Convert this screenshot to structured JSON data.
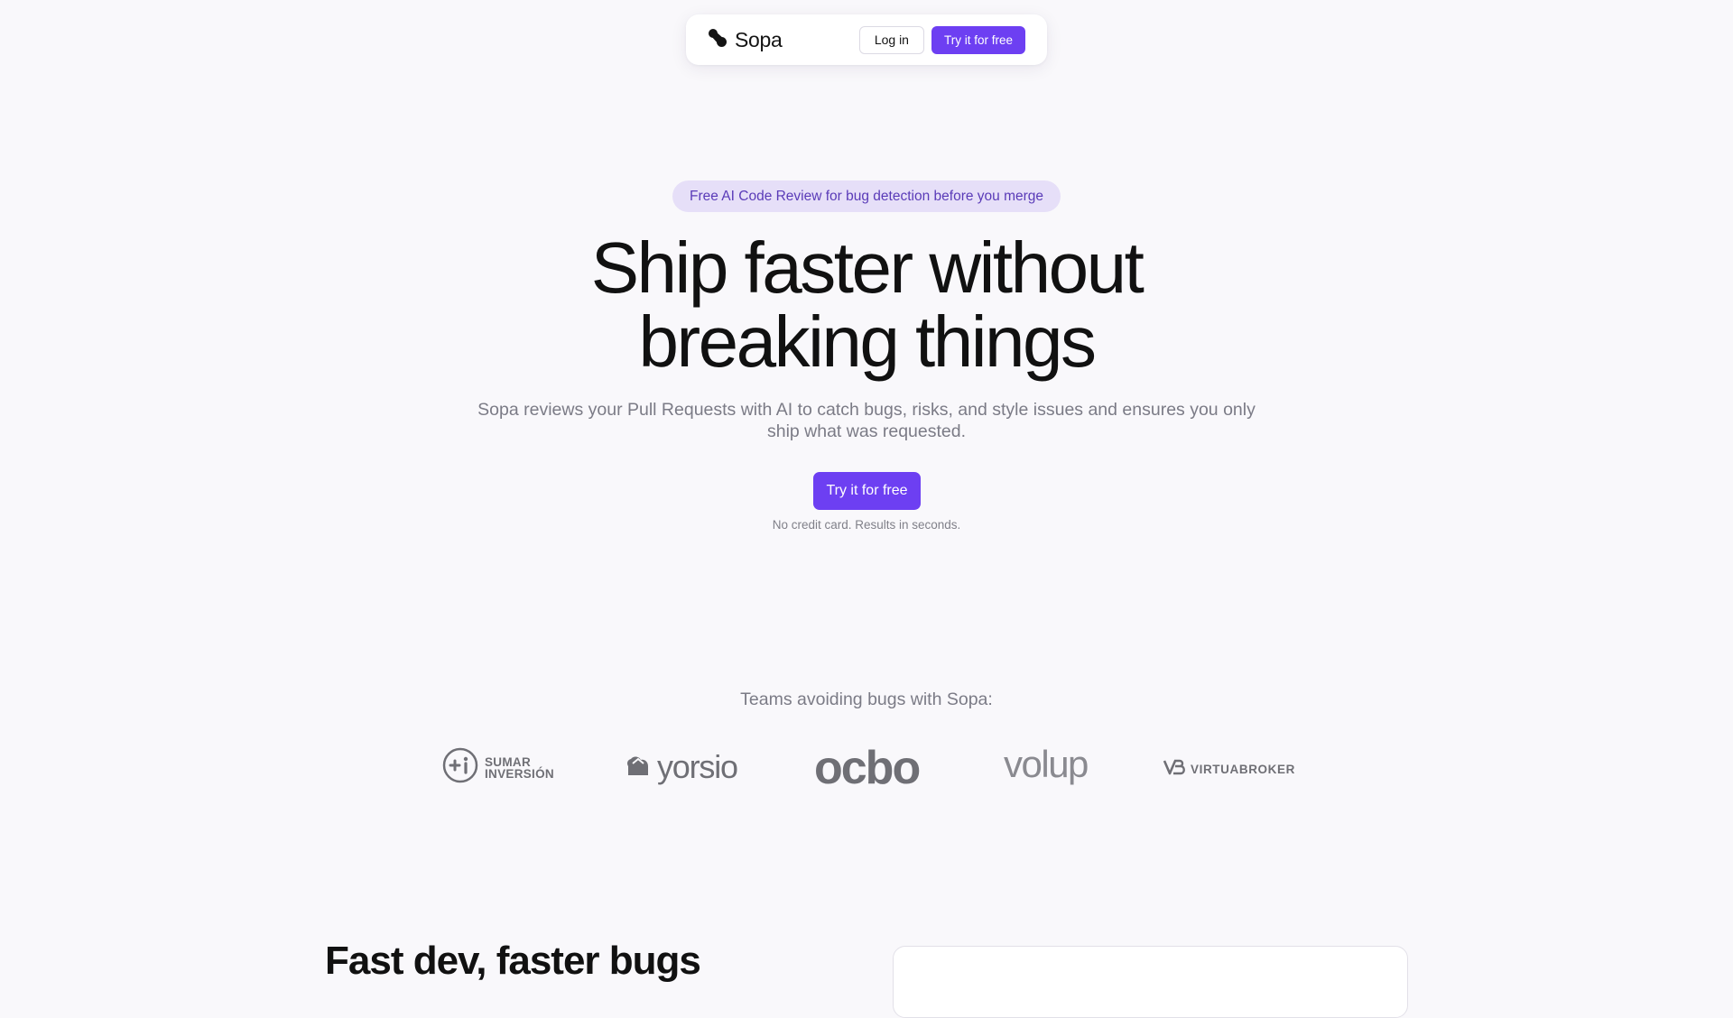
{
  "nav": {
    "brand_name": "Sopa",
    "login_label": "Log in",
    "cta_label": "Try it for free",
    "icons": {
      "logo": "sopa-logo-icon"
    }
  },
  "hero": {
    "badge": "Free AI Code Review for bug detection before you merge",
    "headline_line1": "Ship faster without",
    "headline_line2": "breaking things",
    "subtitle_line1": "Sopa reviews your Pull Requests with AI to catch bugs, risks, and style issues and ensures you only",
    "subtitle_line2": "ship what was requested.",
    "cta_label": "Try it for free",
    "note": "No credit card. Results in seconds."
  },
  "logos": {
    "title": "Teams avoiding bugs with Sopa:",
    "items": [
      {
        "name": "sumar-inversion",
        "line1": "SUMAR",
        "line2": "INVERSIÓN"
      },
      {
        "name": "yorsio",
        "text": "yorsio"
      },
      {
        "name": "ocbo",
        "text": "ocbo"
      },
      {
        "name": "volup",
        "text": "volup"
      },
      {
        "name": "virtuabroker",
        "text": "VIRTUABROKER"
      }
    ]
  },
  "next_section": {
    "title": "Fast dev, faster bugs"
  },
  "colors": {
    "accent": "#6d3ff2",
    "badge_bg": "#e6dff8",
    "badge_text": "#5a3bb8",
    "page_bg": "#f9f8fb"
  }
}
